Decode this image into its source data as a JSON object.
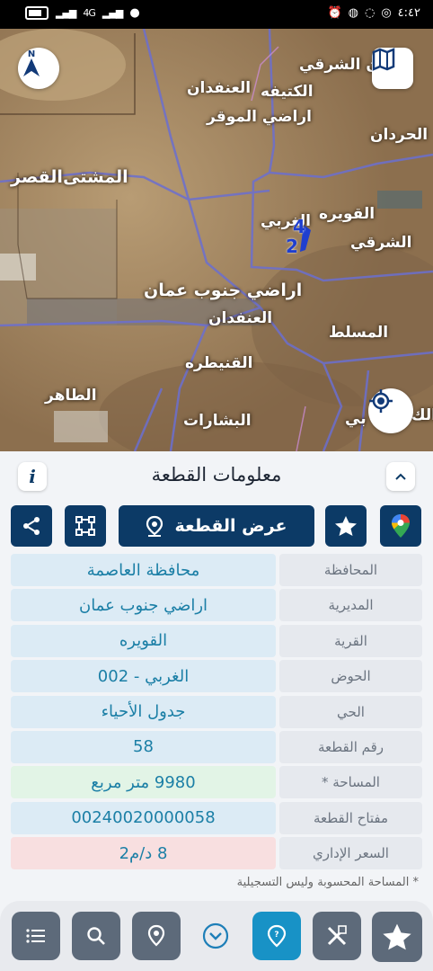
{
  "status_bar": {
    "time": "٤:٤٢",
    "network": "4G"
  },
  "map": {
    "labels": [
      {
        "id": "dan-sharqi",
        "text": "دان الشرقي"
      },
      {
        "id": "aqfan-1",
        "text": "العنفدان"
      },
      {
        "id": "ktefeh",
        "text": "الكتيفه"
      },
      {
        "id": "aradi-muwaqqar",
        "text": "اراضي الموقر"
      },
      {
        "id": "hardan",
        "text": "الحردان"
      },
      {
        "id": "mushatta",
        "text": "المشتى"
      },
      {
        "id": "qasr",
        "text": "القصر"
      },
      {
        "id": "qweira",
        "text": "القويره"
      },
      {
        "id": "gharbi",
        "text": "الغربي"
      },
      {
        "id": "sharqi",
        "text": "الشرقي"
      },
      {
        "id": "aradi-janoub",
        "text": "اراضي جنوب عمان"
      },
      {
        "id": "aqfan-2",
        "text": "العنفدان"
      },
      {
        "id": "maslat",
        "text": "المسلط"
      },
      {
        "id": "qnaitra",
        "text": "القنيطره"
      },
      {
        "id": "taher",
        "text": "الطاهر"
      },
      {
        "id": "bisharat",
        "text": "البشارات"
      },
      {
        "id": "ka",
        "text": "الك"
      },
      {
        "id": "bi",
        "text": "بي"
      }
    ],
    "parcel_numbers": [
      "4",
      "2"
    ],
    "compass_label": "N"
  },
  "sheet": {
    "title": "معلومات القطعة",
    "show_parcel_label": "عرض القطعة",
    "rows": [
      {
        "label": "المحافظة",
        "value": "محافظة العاصمة",
        "tone": "blue"
      },
      {
        "label": "المديرية",
        "value": "اراضي جنوب عمان",
        "tone": "blue"
      },
      {
        "label": "القرية",
        "value": "القويره",
        "tone": "blue"
      },
      {
        "label": "الحوض",
        "value": "الغربي - 002",
        "tone": "blue"
      },
      {
        "label": "الحي",
        "value": "جدول الأحياء",
        "tone": "blue"
      },
      {
        "label": "رقم القطعة",
        "value": "58",
        "tone": "blue"
      },
      {
        "label": "المساحة *",
        "value": "9980   متر مربع",
        "tone": "green"
      },
      {
        "label": "مفتاح القطعة",
        "value": "00240020000058",
        "tone": "blue"
      },
      {
        "label": "السعر الإداري",
        "value": "8 د/م2",
        "tone": "pink"
      }
    ],
    "footnote": "* المساحة المحسوبة وليس التسجيلية"
  },
  "colors": {
    "primary": "#0c3a66",
    "value_text": "#1b7fa6",
    "active_nav": "#1892c6",
    "nav_button": "#5d6a7a"
  }
}
